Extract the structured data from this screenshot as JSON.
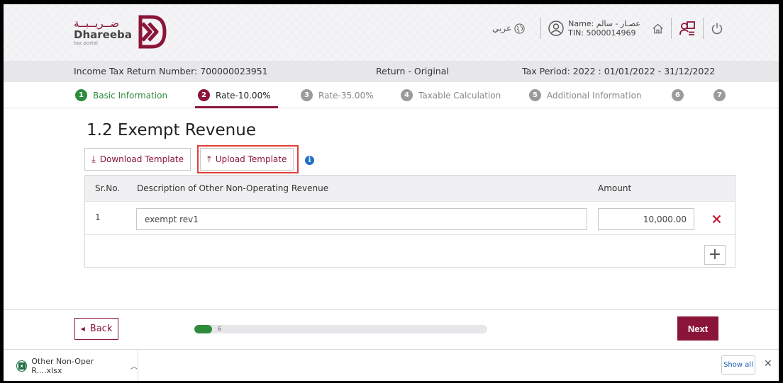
{
  "header": {
    "logo_arabic": "ضــريــبــة",
    "logo_name": "Dhareeba",
    "logo_sub": "tax portal",
    "language": "عربي",
    "user_name": "Name: عصـار - سالم",
    "user_tin": "TIN: 5000014969"
  },
  "infobar": {
    "return_number": "Income Tax Return Number: 700000023951",
    "return_type": "Return - Original",
    "tax_period": "Tax Period: 2022 : 01/01/2022 - 31/12/2022"
  },
  "steps": [
    {
      "num": "1",
      "label": "Basic Information",
      "state": "done"
    },
    {
      "num": "2",
      "label": "Rate-10.00%",
      "state": "active"
    },
    {
      "num": "3",
      "label": "Rate-35.00%",
      "state": "pending"
    },
    {
      "num": "4",
      "label": "Taxable Calculation",
      "state": "pending"
    },
    {
      "num": "5",
      "label": "Additional Information",
      "state": "pending"
    },
    {
      "num": "6",
      "label": "",
      "state": "pending"
    },
    {
      "num": "7",
      "label": "",
      "state": "pending"
    }
  ],
  "section": {
    "title": "1.2 Exempt Revenue",
    "download_label": "Download Template",
    "upload_label": "Upload Template",
    "info_glyph": "i"
  },
  "table": {
    "headers": {
      "sr": "Sr.No.",
      "description": "Description of Other Non-Operating Revenue",
      "amount": "Amount"
    },
    "rows": [
      {
        "sr": "1",
        "description": "exempt rev1",
        "amount": "10,000.00"
      }
    ]
  },
  "footer": {
    "back_label": "Back",
    "next_label": "Next",
    "progress_text": "6",
    "progress_fraction": 0.06
  },
  "downloads": {
    "file_name": "Other Non-Oper R....xlsx",
    "show_all": "Show all"
  },
  "colors": {
    "brand": "#8a1538",
    "success": "#2e8b3c",
    "info": "#1e6fc7",
    "highlight": "#e0403a"
  }
}
